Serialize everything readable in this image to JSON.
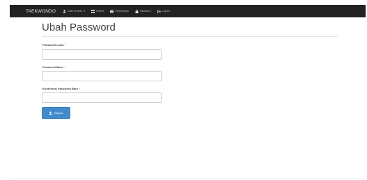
{
  "navbar": {
    "brand": "TAEKWONDO",
    "items": [
      {
        "label": "Data Peserta",
        "icon": "user-icon",
        "dropdown": true
      },
      {
        "label": "Kriteria",
        "icon": "grid-icon"
      },
      {
        "label": "Perhitungan",
        "icon": "list-icon"
      },
      {
        "label": "Password",
        "icon": "lock-icon"
      },
      {
        "label": "Logout",
        "icon": "logout-icon"
      }
    ]
  },
  "page": {
    "title": "Ubah Password"
  },
  "form": {
    "required_mark": "*",
    "old_password_label": "Password Lama",
    "new_password_label": "Password Baru",
    "confirm_password_label": "Konfirmasi Password Baru",
    "old_password_value": "",
    "new_password_value": "",
    "confirm_password_value": "",
    "save_label": "Simpan"
  },
  "colors": {
    "navbar_bg": "#222222",
    "primary_button": "#428bca",
    "required": "#d9534f"
  }
}
